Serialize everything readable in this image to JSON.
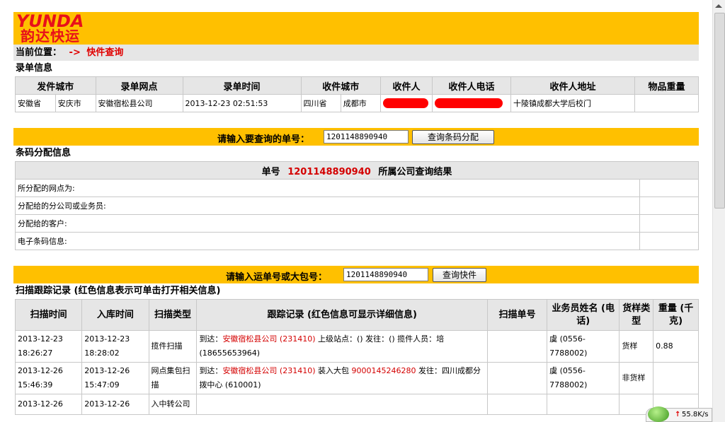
{
  "brand": {
    "en": "YUNDA",
    "cn": "韵达快运"
  },
  "location": {
    "label": "当前位置：",
    "arrow": "->",
    "current": "快件查询"
  },
  "record": {
    "title": "录单信息",
    "headers": [
      "发件城市",
      "录单网点",
      "录单时间",
      "收件城市",
      "收件人",
      "收件人电话",
      "收件人地址",
      "物品重量"
    ],
    "row": {
      "send_province": "安徽省",
      "send_city": "安庆市",
      "outlet": "安徽宿松县公司",
      "time": "2013-12-23 02:51:53",
      "recv_province": "四川省",
      "recv_city": "成都市",
      "address": "十陵镇成都大学后校门",
      "weight": ""
    }
  },
  "barcode_query": {
    "label": "请输入要查询的单号：",
    "value": "1201148890940",
    "button": "查询条码分配"
  },
  "allocation": {
    "title": "条码分配信息",
    "header_prefix": "单号",
    "number": "1201148890940",
    "header_suffix": "所属公司查询结果",
    "rows": [
      "所分配的网点为:",
      "分配给的分公司或业务员:",
      "分配给的客户:",
      "电子条码信息:"
    ]
  },
  "tracking_query": {
    "label": "请输入运单号或大包号：",
    "value": "1201148890940",
    "button": "查询快件"
  },
  "scan": {
    "title": "扫描跟踪记录 (红色信息表示可单击打开相关信息)",
    "headers": [
      "扫描时间",
      "入库时间",
      "扫描类型",
      "跟踪记录 (红色信息可显示详细信息)",
      "扫描单号",
      "业务员姓名 (电话)",
      "货样类型",
      "重量 (千克)"
    ],
    "rows": [
      {
        "scan_date": "2013-12-23",
        "scan_time": "18:26:27",
        "in_date": "2013-12-23",
        "in_time": "18:28:02",
        "type": "揽件扫描",
        "t1": "到达：",
        "t_red": "安徽宿松县公司 (231410)",
        "t2": "上级站点：() 发往：() 揽件人员：培 (18655653964)",
        "scan_no": "",
        "staff": "虞 (0556-7788002)",
        "goods": "货样",
        "weight": "0.88"
      },
      {
        "scan_date": "2013-12-26",
        "scan_time": "15:46:39",
        "in_date": "2013-12-26",
        "in_time": "15:47:09",
        "type": "网点集包扫描",
        "t1": "到达：",
        "t_red": "安徽宿松县公司 (231410)",
        "t2": "装入大包",
        "t_red2": "9000145246280",
        "t3": "发往：四川成都分拨中心 (610001)",
        "scan_no": "",
        "staff": "虞 (0556-7788002)",
        "goods": "非货样",
        "weight": ""
      },
      {
        "scan_date": "2013-12-26",
        "scan_time": "",
        "in_date": "2013-12-26",
        "in_time": "",
        "type": "入中转公司",
        "t1": "",
        "t_red": "",
        "t2": "",
        "scan_no": "",
        "staff": "",
        "goods": "",
        "weight": ""
      }
    ]
  },
  "status": {
    "speed": "55.8K/s"
  },
  "colors": {
    "banner": "#ffc000",
    "brand": "#e8101a",
    "link_red": "#d40000",
    "header_bg": "#e6e6e6"
  }
}
